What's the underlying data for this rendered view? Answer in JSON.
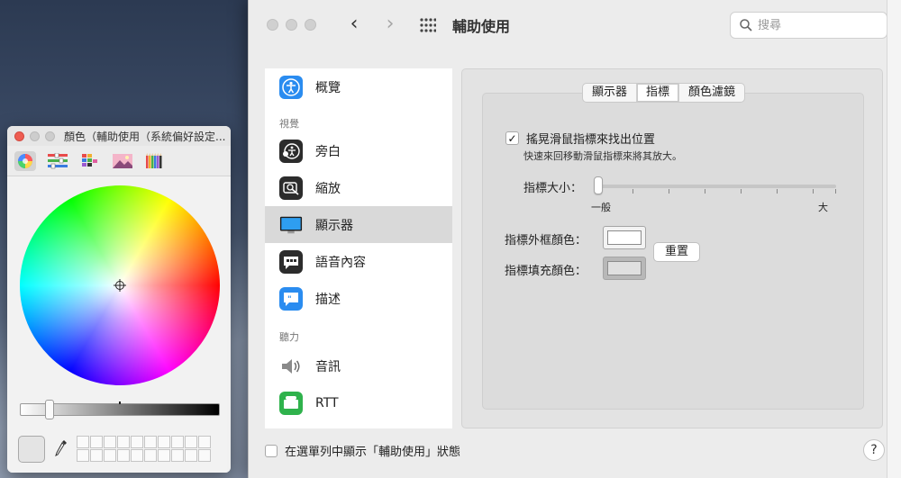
{
  "colors_panel": {
    "title": "顏色（輔助使用（系統偏好設定...",
    "toolbar_icons": [
      "color-wheel-icon",
      "color-sliders-icon",
      "color-palettes-icon",
      "image-palettes-icon",
      "pencils-icon"
    ],
    "selected_tool": "color-wheel-icon"
  },
  "prefs": {
    "title": "輔助使用",
    "search_placeholder": "搜尋",
    "sidebar": {
      "top_item": {
        "label": "概覽",
        "icon": "accessibility-overview-icon"
      },
      "vision_header": "視覺",
      "vision_items": [
        {
          "label": "旁白",
          "icon": "voiceover-icon"
        },
        {
          "label": "縮放",
          "icon": "zoom-icon"
        },
        {
          "label": "顯示器",
          "icon": "display-icon",
          "selected": true
        },
        {
          "label": "語音內容",
          "icon": "spoken-content-icon"
        },
        {
          "label": "描述",
          "icon": "descriptions-icon"
        }
      ],
      "hearing_header": "聽力",
      "hearing_items": [
        {
          "label": "音訊",
          "icon": "audio-icon"
        },
        {
          "label": "RTT",
          "icon": "rtt-icon"
        }
      ]
    },
    "tabs": [
      {
        "label": "顯示器",
        "active": false
      },
      {
        "label": "指標",
        "active": true
      },
      {
        "label": "顏色濾鏡",
        "active": false
      }
    ],
    "pointer": {
      "shake_label": "搖晃滑鼠指標來找出位置",
      "shake_checked": true,
      "shake_hint": "快速來回移動滑鼠指標來將其放大。",
      "size_label": "指標大小：",
      "size_min": "一般",
      "size_max": "大",
      "size_value": 0,
      "outline_label": "指標外框顏色：",
      "outline_color": "#ffffff",
      "fill_label": "指標填充顏色：",
      "fill_color": "#e0e0e0",
      "reset_label": "重置"
    },
    "footer": {
      "menu_status_label": "在選單列中顯示「輔助使用」狀態",
      "menu_status_checked": false,
      "help_label": "?"
    }
  }
}
